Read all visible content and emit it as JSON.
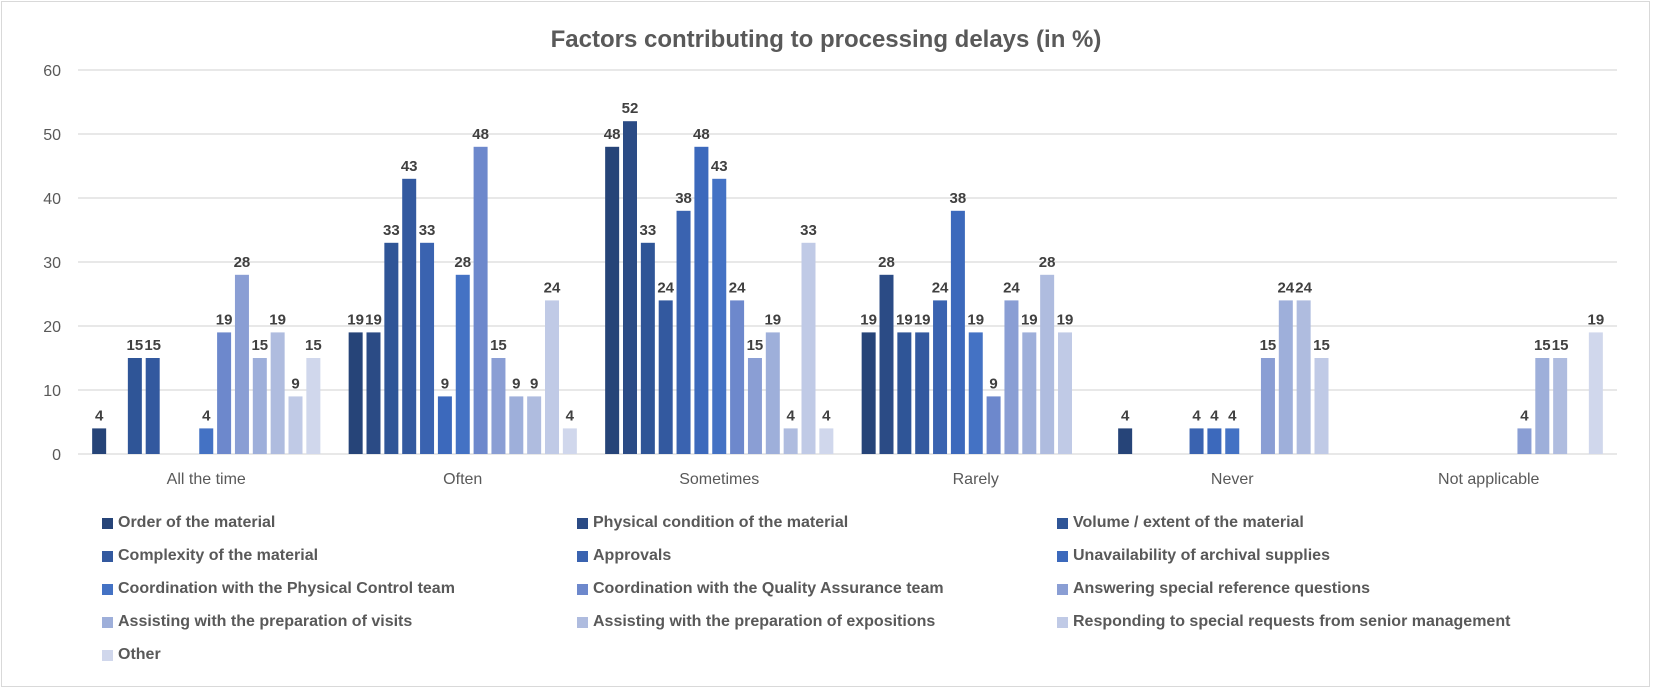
{
  "chart_data": {
    "type": "bar",
    "title": "Factors contributing to processing delays (in %)",
    "xlabel": "",
    "ylabel": "",
    "ylim": [
      0,
      60
    ],
    "yticks": [
      "0",
      "10",
      "20",
      "30",
      "40",
      "50",
      "60"
    ],
    "grid": true,
    "legend_position": "bottom",
    "categories": [
      "All the time",
      "Often",
      "Sometimes",
      "Rarely",
      "Never",
      "Not applicable"
    ],
    "series": [
      {
        "name": "Order of the material",
        "color": "#264478",
        "values": [
          4,
          19,
          48,
          19,
          4,
          0
        ]
      },
      {
        "name": "Physical condition of the material",
        "color": "#2b4b85",
        "values": [
          0,
          19,
          52,
          28,
          0,
          0
        ]
      },
      {
        "name": "Volume / extent of the material",
        "color": "#2f5597",
        "values": [
          15,
          33,
          33,
          19,
          0,
          0
        ]
      },
      {
        "name": "Complexity of the material",
        "color": "#33599f",
        "values": [
          15,
          43,
          24,
          19,
          0,
          0
        ]
      },
      {
        "name": "Approvals",
        "color": "#3a63b0",
        "values": [
          0,
          33,
          38,
          24,
          4,
          0
        ]
      },
      {
        "name": "Unavailability of archival supplies",
        "color": "#3c69bc",
        "values": [
          0,
          9,
          48,
          38,
          4,
          0
        ]
      },
      {
        "name": "Coordination with the Physical Control team",
        "color": "#4472c4",
        "values": [
          4,
          28,
          43,
          19,
          4,
          0
        ]
      },
      {
        "name": "Coordination with the Quality Assurance team",
        "color": "#6d88cc",
        "values": [
          19,
          48,
          24,
          9,
          0,
          0
        ]
      },
      {
        "name": "Answering special reference questions",
        "color": "#8a9ed4",
        "values": [
          28,
          15,
          15,
          24,
          15,
          4
        ]
      },
      {
        "name": "Assisting with the preparation of visits",
        "color": "#9eafda",
        "values": [
          15,
          9,
          19,
          19,
          24,
          15
        ]
      },
      {
        "name": "Assisting with the preparation of expositions",
        "color": "#afbcdf",
        "values": [
          19,
          9,
          4,
          28,
          24,
          15
        ]
      },
      {
        "name": "Responding to special requests from senior management",
        "color": "#c0cae6",
        "values": [
          9,
          24,
          33,
          19,
          15,
          0
        ]
      },
      {
        "name": "Other",
        "color": "#d0d7ec",
        "values": [
          15,
          4,
          4,
          0,
          0,
          19
        ]
      }
    ]
  }
}
